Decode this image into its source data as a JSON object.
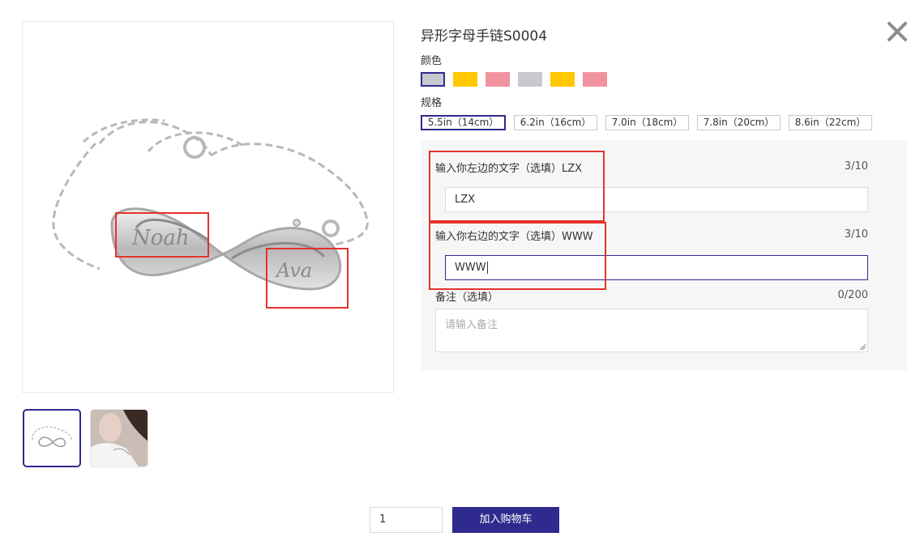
{
  "product": {
    "title": "异形字母手链S0004"
  },
  "color": {
    "label": "颜色",
    "swatches": [
      {
        "name": "silver",
        "hex": "#c8c9ce",
        "selected": true
      },
      {
        "name": "gold",
        "hex": "#ffc800",
        "selected": false
      },
      {
        "name": "rose",
        "hex": "#f0939e",
        "selected": false
      },
      {
        "name": "silver",
        "hex": "#c8c9ce",
        "selected": false
      },
      {
        "name": "gold",
        "hex": "#ffc800",
        "selected": false
      },
      {
        "name": "rose",
        "hex": "#f0939e",
        "selected": false
      }
    ]
  },
  "size": {
    "label": "规格",
    "options": [
      "5.5in（14cm）",
      "6.2in（16cm）",
      "7.0in（18cm）",
      "7.8in（20cm）",
      "8.6in（22cm）"
    ],
    "selected": 0
  },
  "form": {
    "left_text": {
      "label": "输入你左边的文字（选填）LZX",
      "value": "LZX",
      "count": "3/10"
    },
    "right_text": {
      "label": "输入你右边的文字（选填）WWW",
      "value": "WWW",
      "count": "3/10"
    },
    "notes": {
      "label": "备注（选填）",
      "placeholder": "请输入备注",
      "count": "0/200"
    }
  },
  "cart": {
    "quantity": "1",
    "button_label": "加入购物车"
  },
  "colors": {
    "accent": "#2f2b8e",
    "highlight": "#e4322b",
    "panel_bg": "#f6f6f7"
  }
}
